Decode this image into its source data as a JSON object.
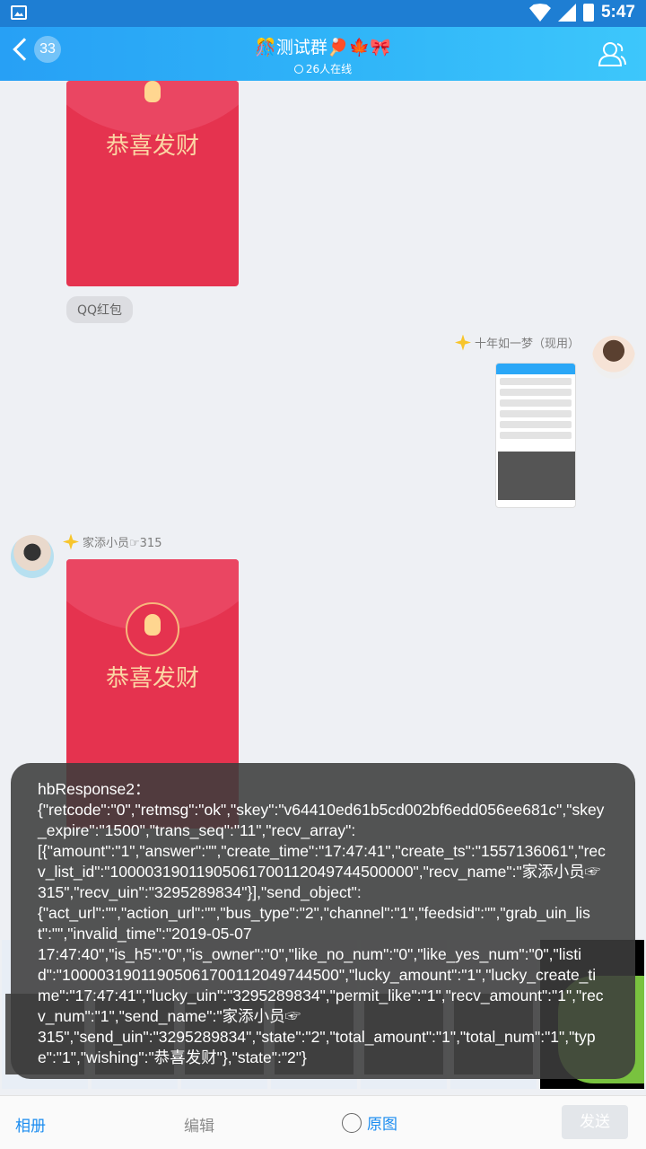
{
  "status_bar": {
    "time": "5:47"
  },
  "header": {
    "back_count": "33",
    "title": "🎊测试群🏓🍁🎀",
    "subtitle": "26人在线"
  },
  "chat": {
    "messages": [
      {
        "type": "red_packet",
        "wish": "恭喜发财",
        "tag": "QQ红包"
      },
      {
        "type": "image",
        "sender": "十年如一梦（现用）"
      },
      {
        "type": "red_packet",
        "sender": "家添小员☞315",
        "wish": "恭喜发财"
      }
    ]
  },
  "toast": {
    "text": "hbResponse2：\n{\"retcode\":\"0\",\"retmsg\":\"ok\",\"skey\":\"v64410ed61b5cd002bf6edd056ee681c\",\"skey_expire\":\"1500\",\"trans_seq\":\"11\",\"recv_array\":\n[{\"amount\":\"1\",\"answer\":\"\",\"create_time\":\"17:47:41\",\"create_ts\":\"1557136061\",\"recv_list_id\":\"10000319011905061700112049744500000\",\"recv_name\":\"家添小员☞\n315\",\"recv_uin\":\"3295289834\"}],\"send_object\":\n{\"act_url\":\"\",\"action_url\":\"\",\"bus_type\":\"2\",\"channel\":\"1\",\"feedsid\":\"\",\"grab_uin_list\":\"\",\"invalid_time\":\"2019-05-07\n17:47:40\",\"is_h5\":\"0\",\"is_owner\":\"0\",\"like_no_num\":\"0\",\"like_yes_num\":\"0\",\"listid\":\"10000319011905061700112049744500\",\"lucky_amount\":\"1\",\"lucky_create_time\":\"17:47:41\",\"lucky_uin\":\"3295289834\",\"permit_like\":\"1\",\"recv_amount\":\"1\",\"recv_num\":\"1\",\"send_name\":\"家添小员☞\n315\",\"send_uin\":\"3295289834\",\"state\":\"2\",\"total_amount\":\"1\",\"total_num\":\"1\",\"type\":\"1\",\"wishing\":\"恭喜发财\"},\"state\":\"2\"}"
  },
  "bottom_bar": {
    "album": "相册",
    "edit": "编辑",
    "original": "原图",
    "send": "发送"
  },
  "colors": {
    "header_start": "#27a0f5",
    "header_end": "#3dc7fb",
    "red_packet": "#e5334f",
    "accent": "#1a8cf0"
  }
}
